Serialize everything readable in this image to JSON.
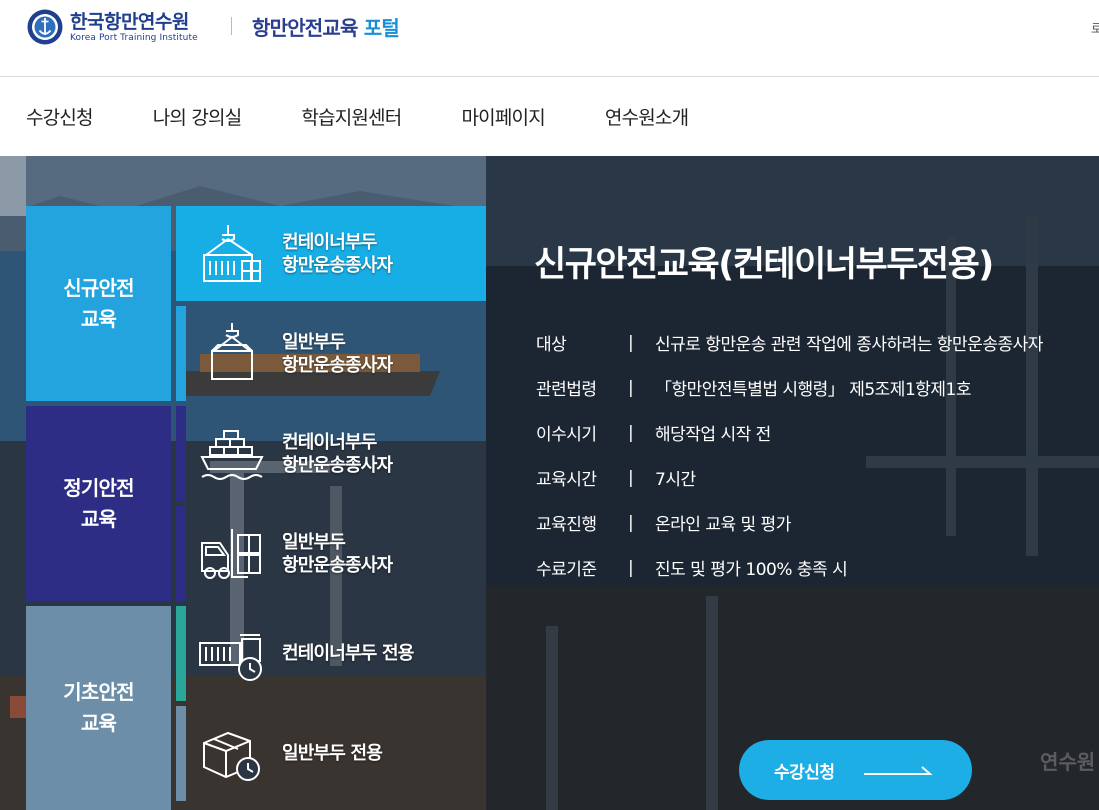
{
  "header": {
    "logo_ko": "한국항만연수원",
    "logo_en": "Korea Port Training Institute",
    "portal_part1": "항만안전교육",
    "portal_part2": "포털",
    "right_text": "로"
  },
  "nav": [
    "수강신청",
    "나의 강의실",
    "학습지원센터",
    "마이페이지",
    "연수원소개"
  ],
  "categories": [
    {
      "line1": "신규안전",
      "line2": "교육",
      "color": "#23a4df"
    },
    {
      "line1": "정기안전",
      "line2": "교육",
      "color": "#2d2d86"
    },
    {
      "line1": "기초안전",
      "line2": "교육",
      "color": "#6c8ea8"
    }
  ],
  "courses": [
    {
      "line1": "컨테이너부두",
      "line2": "항만운송종사자",
      "icon": "container-crane-icon",
      "active": true
    },
    {
      "line1": "일반부두",
      "line2": "항만운송종사자",
      "icon": "cargo-box-hook-icon",
      "active": false
    },
    {
      "line1": "컨테이너부두",
      "line2": "항만운송종사자",
      "icon": "container-ship-icon",
      "active": false
    },
    {
      "line1": "일반부두",
      "line2": "항만운송종사자",
      "icon": "forklift-cargo-icon",
      "active": false
    },
    {
      "line1": "컨테이너부두 전용",
      "line2": "",
      "icon": "container-clock-icon",
      "active": false
    },
    {
      "line1": "일반부두 전용",
      "line2": "",
      "icon": "box-clock-icon",
      "active": false
    }
  ],
  "detail": {
    "title": "신규안전교육(컨테이너부두전용)",
    "rows": [
      {
        "key": "대상",
        "value": "신규로 항만운송 관련 작업에 종사하려는 항만운송종사자"
      },
      {
        "key": "관련법령",
        "value": "「항만안전특별법 시행령」 제5조제1항제1호"
      },
      {
        "key": "이수시기",
        "value": "해당작업 시작 전"
      },
      {
        "key": "교육시간",
        "value": "7시간"
      },
      {
        "key": "교육진행",
        "value": "온라인 교육 및 평가"
      },
      {
        "key": "수료기준",
        "value": "진도 및 평가 100% 충족 시"
      }
    ],
    "separator": "|",
    "apply_label": "수강신청",
    "watermark": "연수원"
  },
  "colors": {
    "accent": "#17aee6",
    "navy": "#2d2d86",
    "brand": "#1f3f8f"
  }
}
